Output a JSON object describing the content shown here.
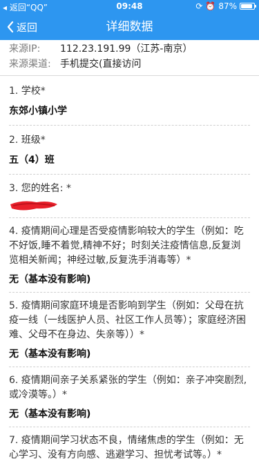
{
  "status_bar": {
    "back_label": "返回“QQ”",
    "time": "09:48",
    "battery": "87%",
    "battery_fraction": 0.87
  },
  "nav": {
    "back_label": "返回",
    "title": "详细数据"
  },
  "source": {
    "ip_label": "来源IP:",
    "ip_value": "112.23.191.99（江苏-南京）",
    "channel_label": "来源渠道:",
    "channel_value": "手机提交(直接访问"
  },
  "questions": [
    {
      "title": "1. 学校*",
      "answer": "东郊小镇小学"
    },
    {
      "title": "2. 班级*",
      "answer": "五（4）班"
    },
    {
      "title": "3. 您的姓名: *",
      "answer": ""
    },
    {
      "title": "4. 疫情期间心理是否受疫情影响较大的学生（例如：吃不好饭,睡不着觉,精神不好；时刻关注疫情信息,反复浏览相关新闻；神经过敏,反复洗手消毒等）*",
      "answer": "无（基本没有影响)"
    },
    {
      "title": "5. 疫情期间家庭环境是否影响到学生（例如：父母在抗疫一线（一线医护人员、社区工作人员等）；家庭经济困难、父母不在身边、失亲等））*",
      "answer": "无（基本没有影响)"
    },
    {
      "title": "6. 疫情期间亲子关系紧张的学生（例如：亲子冲突剧烈,或冷漠等。）*",
      "answer": "无（基本没有影响)"
    },
    {
      "title": "7. 疫情期间学习状态不良，情绪焦虑的学生（例如：无心学习、没有方向感、逃避学习、担忧考试等。）*",
      "answer": ""
    }
  ],
  "colors": {
    "header": "#2d96f0",
    "redaction": "#e8202a"
  }
}
